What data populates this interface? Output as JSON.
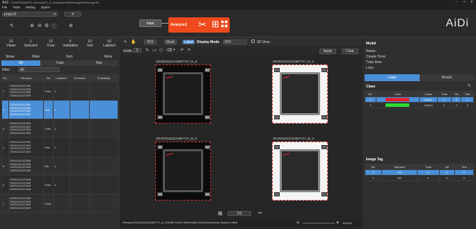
{
  "window": {
    "app": "AiDi",
    "path": "D:\\AIDI\\Sales\\02_Kaccsdo\\01_R_dbk\\project\\MultiImage\\Multiimage.db"
  },
  "menu": [
    "File",
    "Tools",
    "Setting",
    "Option"
  ],
  "project": {
    "name": "project1",
    "page": "4"
  },
  "flow": {
    "input": "Input",
    "analyze": "Analyze1"
  },
  "brand": "AiDi",
  "stats": [
    {
      "value": "21",
      "label": "Views"
    },
    {
      "value": "1",
      "label": "Selected"
    },
    {
      "value": "12",
      "label": "Train"
    },
    {
      "value": "5",
      "label": "Validation"
    },
    {
      "value": "10",
      "label": "Test"
    },
    {
      "value": "10",
      "label": "Labeled"
    }
  ],
  "stat_buttons": [
    "Show",
    "Filter",
    "Sort",
    "More"
  ],
  "view_tabs": [
    "All",
    "Train",
    "Test"
  ],
  "filter": {
    "label": "Filter",
    "value": "All"
  },
  "list_headers": [
    "No.",
    "Filename",
    "Set",
    "Labeled?",
    "Detected",
    "Probability"
  ],
  "list_rows": [
    {
      "no": "1",
      "files": [
        "OK2021111121259",
        "OK2021111121259",
        "OK2021111121259",
        "OK2021111121259"
      ],
      "set": "Train",
      "labeled": "1",
      "selected": false
    },
    {
      "no": "2",
      "files": [
        "OK2021111121263",
        "OK2021111121263",
        "OK2021111121263",
        "OK2021111121263"
      ],
      "set": "Test",
      "labeled": "1",
      "selected": true
    },
    {
      "no": "3",
      "files": [
        "OK2021111121303",
        "OK2021111121303",
        "OK2021111121303",
        "OK2021111121303"
      ],
      "set": "Train",
      "labeled": "1",
      "selected": false
    },
    {
      "no": "4",
      "files": [
        "OK2021111121304",
        "OK2021111121304",
        "OK2021111121304",
        "OK2021111121304"
      ],
      "set": "Test",
      "labeled": "2",
      "selected": false
    },
    {
      "no": "5",
      "files": [
        "OK2021111121305",
        "OK2021111121305",
        "OK2021111121305",
        "OK2021111121305"
      ],
      "set": "Val",
      "labeled": "1",
      "selected": false
    },
    {
      "no": "6",
      "files": [
        "OK2021111121348",
        "OK2021111121348",
        "OK2021111121348",
        "OK2021111121348"
      ],
      "set": "Train",
      "labeled": "1",
      "selected": false
    },
    {
      "no": "7",
      "files": [
        "OK2021111121349",
        "OK2021111121349",
        "OK2021111121349",
        "OK2021111121349"
      ],
      "set": "Train",
      "labeled": "",
      "selected": false
    }
  ],
  "toolbar": {
    "roi": "ROI",
    "mask": "Mask",
    "label": "Label",
    "display_mode": "Display Mode",
    "display_value": "ROI",
    "view3d": "3D View",
    "width_label": "Width",
    "width_value": "3",
    "apply": "Apply",
    "clear": "Clear"
  },
  "images": [
    {
      "title": "OK20211111212657717_te_0",
      "white": false
    },
    {
      "title": "OK20211111212657717_te_1",
      "white": true
    },
    {
      "title": "OK20211111212657717_te_2",
      "white": false
    },
    {
      "title": "OK20211111212657717_te_3",
      "white": true
    }
  ],
  "pager": {
    "value": "2/2"
  },
  "statusbar": {
    "info": "Filename:OK20211111212657717_te_0  W:960 H:640  (TileSize:666,716)  Extension:bmp  Channel:1  Bit:8",
    "zoom": "100.0%"
  },
  "model": {
    "title": "Model",
    "fields": [
      "Name:",
      "Create Time:",
      "Train time:",
      "Loss:"
    ]
  },
  "right_tabs": [
    "Label",
    "Result"
  ],
  "class_panel": {
    "title": "Class",
    "headers": [
      "No.",
      "Color",
      "Class",
      "Train",
      "Val",
      "Test"
    ],
    "rows": [
      {
        "no": "1",
        "color": "#e8222a",
        "name": "Class1",
        "train": "3",
        "val": "2",
        "test": "1",
        "selected": true
      },
      {
        "no": "2",
        "color": "#2fdc2f",
        "name": "Class2",
        "train": "2",
        "val": "0",
        "test": "2",
        "selected": false
      }
    ]
  },
  "tag_panel": {
    "title": "Image Tag",
    "headers": [
      "No.",
      "Tagname",
      "Train",
      "Val",
      "Test"
    ],
    "rows": [
      {
        "no": "1",
        "name": "OK",
        "train": "0",
        "val": "0",
        "test": "0",
        "selected": true
      },
      {
        "no": "2",
        "name": "NG",
        "train": "0",
        "val": "0",
        "test": "0",
        "selected": false
      }
    ]
  }
}
